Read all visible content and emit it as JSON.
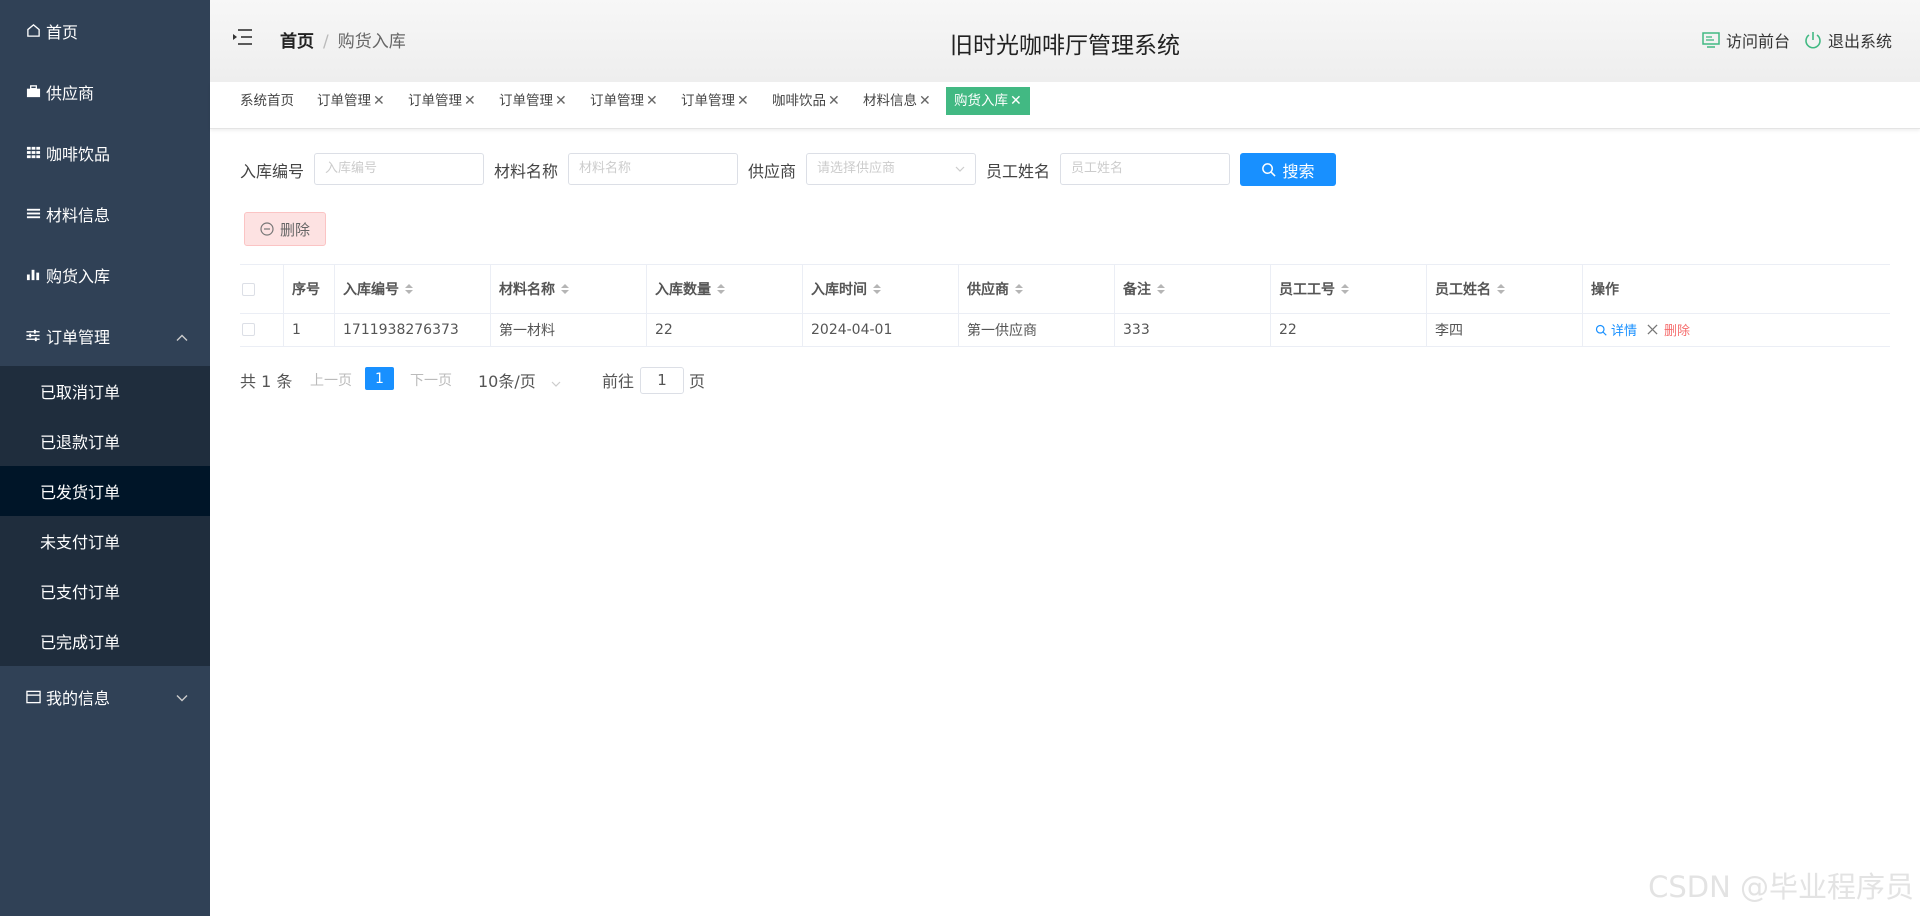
{
  "sidebar": {
    "items": [
      {
        "label": "首页",
        "icon": "home-icon"
      },
      {
        "label": "供应商",
        "icon": "briefcase-icon"
      },
      {
        "label": "咖啡饮品",
        "icon": "grid-icon"
      },
      {
        "label": "材料信息",
        "icon": "list-icon"
      },
      {
        "label": "购货入库",
        "icon": "bar-chart-icon"
      },
      {
        "label": "订单管理",
        "icon": "sliders-icon"
      },
      {
        "label": "我的信息",
        "icon": "id-card-icon"
      }
    ],
    "order_sub": [
      "已取消订单",
      "已退款订单",
      "已发货订单",
      "未支付订单",
      "已支付订单",
      "已完成订单"
    ]
  },
  "header": {
    "breadcrumb_home": "首页",
    "breadcrumb_sep": "/",
    "breadcrumb_current": "购货入库",
    "system_title": "旧时光咖啡厅管理系统",
    "visit_front": "访问前台",
    "logout": "退出系统"
  },
  "tabs": [
    {
      "label": "系统首页"
    },
    {
      "label": "订单管理",
      "close": "✕"
    },
    {
      "label": "订单管理",
      "close": "✕"
    },
    {
      "label": "订单管理",
      "close": "✕"
    },
    {
      "label": "订单管理",
      "close": "✕"
    },
    {
      "label": "订单管理",
      "close": "✕"
    },
    {
      "label": "咖啡饮品",
      "close": "✕"
    },
    {
      "label": "材料信息",
      "close": "✕"
    },
    {
      "label": "购货入库",
      "close": "✕"
    }
  ],
  "search": {
    "entry_no_label": "入库编号",
    "entry_no_placeholder": "入库编号",
    "material_label": "材料名称",
    "material_placeholder": "材料名称",
    "supplier_label": "供应商",
    "supplier_placeholder": "请选择供应商",
    "staff_label": "员工姓名",
    "staff_placeholder": "员工姓名",
    "search_button": "搜索"
  },
  "toolbar": {
    "delete_label": "删除"
  },
  "table": {
    "headers": [
      "序号",
      "入库编号",
      "材料名称",
      "入库数量",
      "入库时间",
      "供应商",
      "备注",
      "员工工号",
      "员工姓名",
      "操作"
    ],
    "rows": [
      {
        "index": "1",
        "entry_no": "1711938276373",
        "material": "第一材料",
        "quantity": "22",
        "time": "2024-04-01",
        "supplier": "第一供应商",
        "remark": "333",
        "staff_no": "22",
        "staff_name": "李四"
      }
    ],
    "detail_label": "详情",
    "delete_label": "删除"
  },
  "pagination": {
    "total": "共 1 条",
    "prev": "上一页",
    "page": "1",
    "next": "下一页",
    "size": "10条/页",
    "goto": "前往",
    "goto_value": "1",
    "page_unit": "页"
  },
  "watermark": "CSDN @毕业程序员",
  "colors": {
    "sidebar": "#304156",
    "active_tab": "#42b983",
    "primary": "#1890ff",
    "danger": "#f56c6c"
  }
}
